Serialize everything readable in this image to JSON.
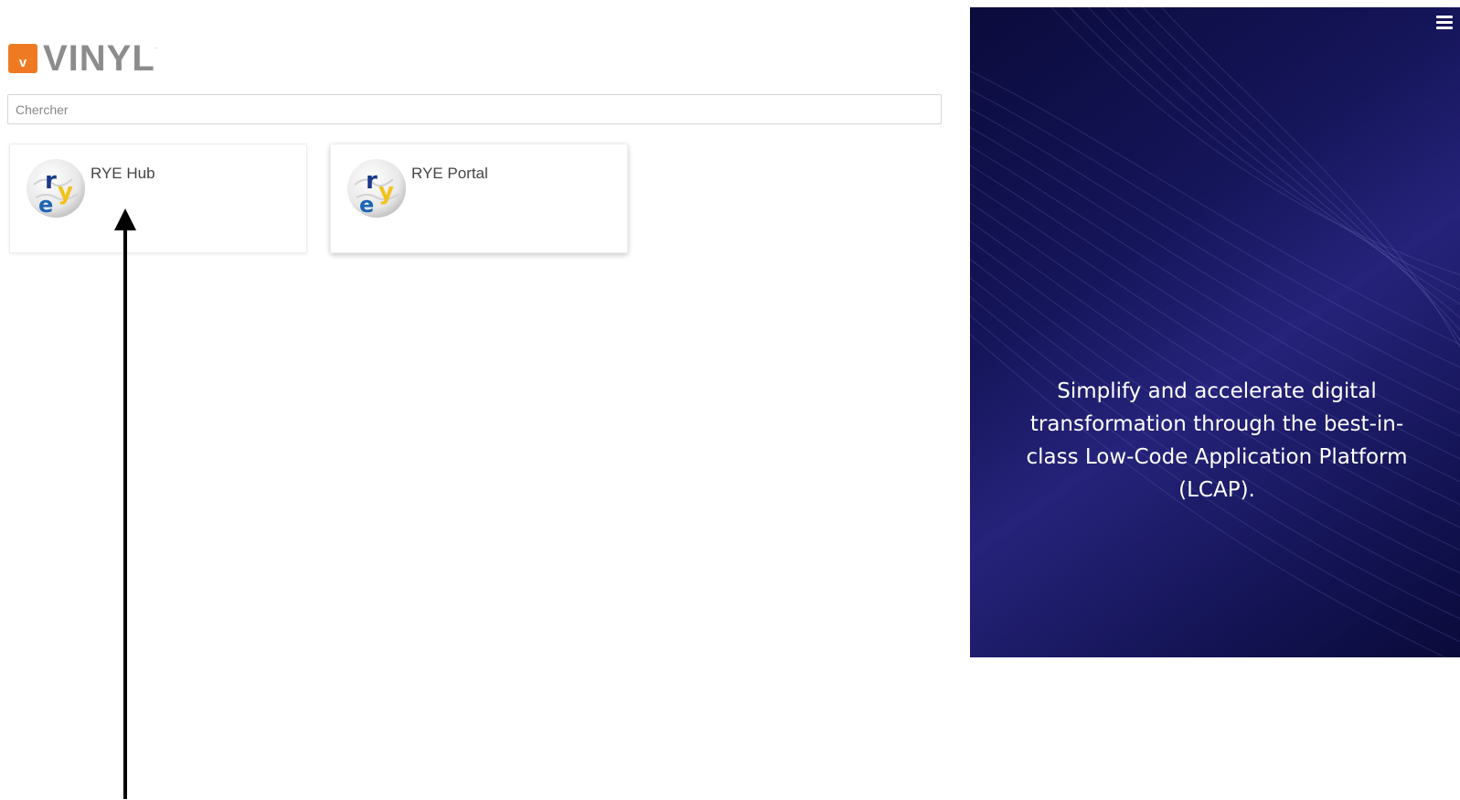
{
  "logo": {
    "badge_letter": "v",
    "word": "VINYL",
    "tm": "."
  },
  "search": {
    "placeholder": "Chercher",
    "value": ""
  },
  "tiles": [
    {
      "label": "RYE Hub",
      "icon": "rye-logo-icon"
    },
    {
      "label": "RYE Portal",
      "icon": "rye-logo-icon"
    }
  ],
  "panel": {
    "tagline": "Simplify and accelerate digital transformation through the best-in-class Low-Code Application Platform (LCAP).",
    "menu_icon": "hamburger-menu-icon"
  },
  "colors": {
    "brand_orange": "#ee7b23",
    "logo_gray": "#8c8c8c",
    "panel_navy": "#15155a",
    "rye_blue": "#1c64b4",
    "rye_yellow": "#f2c21a"
  }
}
